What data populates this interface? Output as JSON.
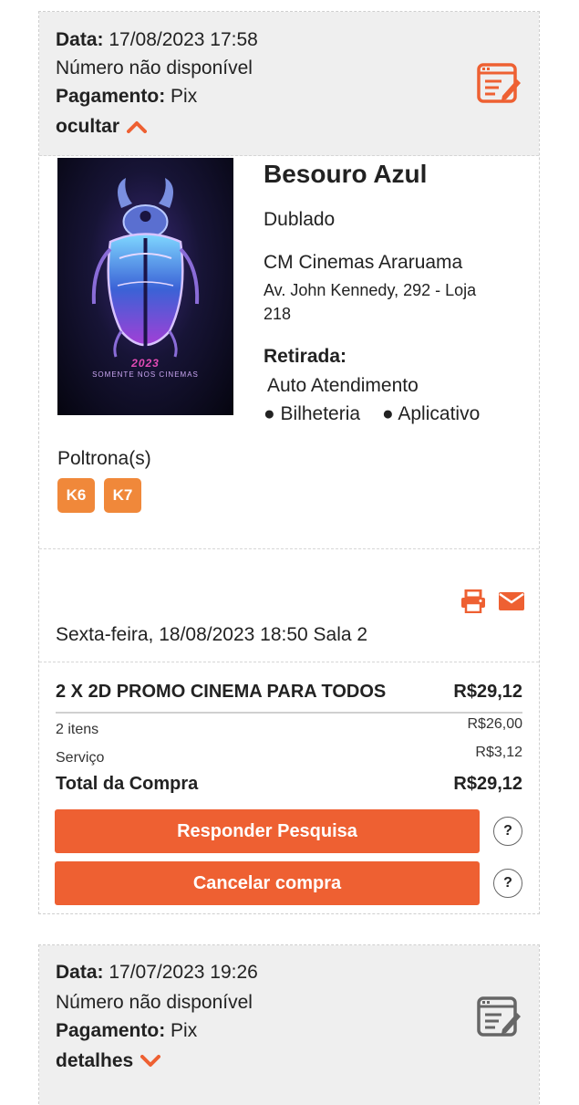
{
  "orders": [
    {
      "date_label": "Data:",
      "date_value": "17/08/2023 17:58",
      "number_text": "Número não disponível",
      "payment_label": "Pagamento:",
      "payment_value": "Pix",
      "toggle_label": "ocultar",
      "receipt_icon": "receipt-edit-icon",
      "movie": {
        "poster_year": "2023",
        "poster_tagline": "SOMENTE NOS CINEMAS",
        "title": "Besouro Azul",
        "version": "Dublado",
        "cinema_name": "CM Cinemas Araruama",
        "address_line1": "Av. John Kennedy, 292 - Loja",
        "address_line2": "218",
        "pickup_label": "Retirada:",
        "pickup_option1": "Auto Atendimento",
        "pickup_option2": "Bilheteria",
        "pickup_option3": "Aplicativo"
      },
      "seats_label": "Poltrona(s)",
      "seats": [
        "K6",
        "K7"
      ],
      "session": "Sexta-feira, 18/08/2023 18:50 Sala 2",
      "product_name": "2 X 2D PROMO CINEMA PARA TODOS",
      "product_price": "R$29,12",
      "items_label": "2 itens",
      "items_value": "R$26,00",
      "service_label": "Serviço",
      "service_value": "R$3,12",
      "total_label": "Total da Compra",
      "total_value": "R$29,12",
      "survey_button": "Responder Pesquisa",
      "cancel_button": "Cancelar compra",
      "help_symbol": "?"
    },
    {
      "date_label": "Data:",
      "date_value": "17/07/2023 19:26",
      "number_text": "Número não disponível",
      "payment_label": "Pagamento:",
      "payment_value": "Pix",
      "toggle_label": "detalhes",
      "receipt_icon": "receipt-edit-icon"
    }
  ],
  "colors": {
    "accent": "#ee6032",
    "seat": "#f0883a",
    "header_bg": "#efefef",
    "receipt_icon_active": "#ee6032",
    "receipt_icon_inactive": "#666666"
  }
}
